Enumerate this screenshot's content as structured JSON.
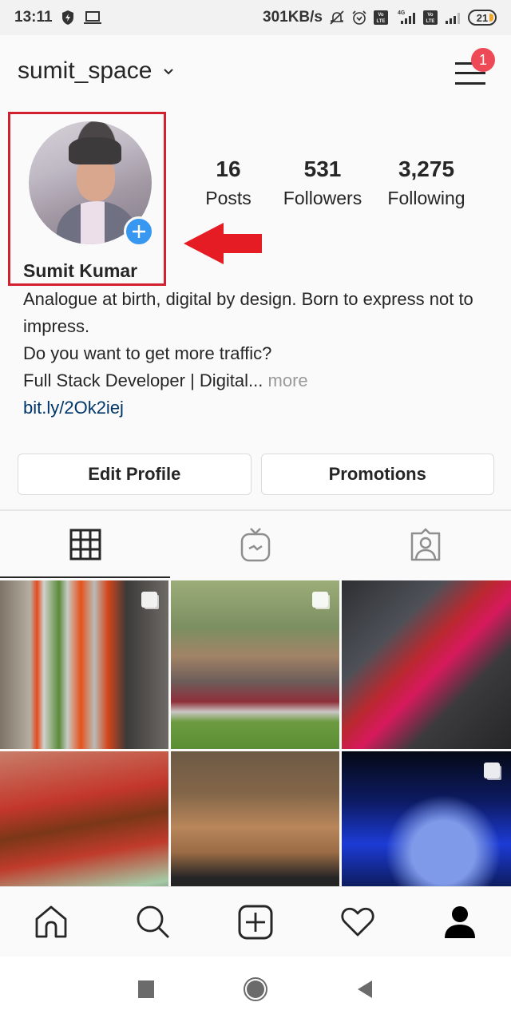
{
  "status_bar": {
    "time": "13:11",
    "left_icons": [
      "shield-bolt-icon",
      "laptop-icon"
    ],
    "network_speed": "301KB/s",
    "right_icons": [
      "bell-off-icon",
      "alarm-icon",
      "volte-icon",
      "signal-4g-icon",
      "volte-icon",
      "signal-icon"
    ],
    "network_label": "4G",
    "battery_level": "21"
  },
  "header": {
    "username": "sumit_space",
    "menu_badge_count": "1"
  },
  "profile": {
    "full_name": "Sumit Kumar",
    "stats": [
      {
        "value": "16",
        "label": "Posts"
      },
      {
        "value": "531",
        "label": "Followers"
      },
      {
        "value": "3,275",
        "label": "Following"
      }
    ],
    "bio_lines": [
      "Analogue at birth, digital by design. Born to express not to impress.",
      "Do you want to get more traffic?",
      "Full Stack Developer | Digital..."
    ],
    "bio_more": " more",
    "bio_link": "bit.ly/2Ok2iej"
  },
  "annotation": {
    "highlight_color": "#d32030",
    "arrow_color": "#e51c23"
  },
  "actions": {
    "edit_profile": "Edit Profile",
    "promotions": "Promotions"
  },
  "tabs": [
    {
      "name": "grid",
      "icon": "grid-icon",
      "active": true
    },
    {
      "name": "igtv",
      "icon": "igtv-icon",
      "active": false
    },
    {
      "name": "tagged",
      "icon": "tagged-icon",
      "active": false
    }
  ],
  "posts": [
    {
      "description": "office corridor with marigold garlands",
      "multi": true
    },
    {
      "description": "multi-headed serpent statue in garden",
      "multi": true
    },
    {
      "description": "restaurant table with pink bottle",
      "multi": false
    },
    {
      "description": "food tray with curry bowl and rice",
      "multi": false
    },
    {
      "description": "coffee mug on wooden table",
      "multi": false
    },
    {
      "description": "blue-lit screen close-up",
      "multi": true
    }
  ],
  "bottom_nav": [
    "home-icon",
    "search-icon",
    "new-post-icon",
    "activity-heart-icon",
    "profile-icon"
  ],
  "system_nav": [
    "recents-icon",
    "home-circle-icon",
    "back-icon"
  ],
  "colors": {
    "badge": "#ed4956",
    "add_story": "#3897f0",
    "link": "#003569",
    "muted": "#999999"
  }
}
